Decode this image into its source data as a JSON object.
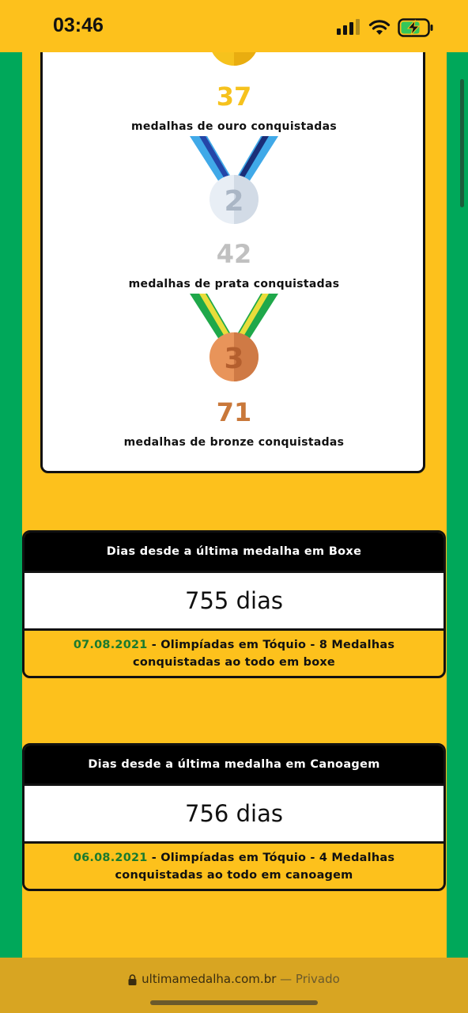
{
  "status_bar": {
    "time": "03:46"
  },
  "medals": {
    "gold": {
      "count": "37",
      "caption": "medalhas de ouro conquistadas",
      "color": "#f6c21d"
    },
    "silver": {
      "count": "42",
      "caption": "medalhas de prata conquistadas",
      "color": "#c0c0c0",
      "badge": "2"
    },
    "bronze": {
      "count": "71",
      "caption": "medalhas de bronze conquistadas",
      "color": "#c9783a",
      "badge": "3"
    }
  },
  "cards": [
    {
      "header": "Dias desde a última medalha em Boxe",
      "days": "755 dias",
      "date": "07.08.2021",
      "description": " - Olimpíadas em Tóquio - 8 Medalhas conquistadas ao todo em boxe"
    },
    {
      "header": "Dias desde a última medalha em Canoagem",
      "days": "756 dias",
      "date": "06.08.2021",
      "description": " - Olimpíadas em Tóquio - 4 Medalhas conquistadas ao todo em canoagem"
    }
  ],
  "browser": {
    "url": "ultimamedalha.com.br",
    "privacy": " — Privado"
  },
  "colors": {
    "brand_yellow": "#fdc11c",
    "brand_green": "#00a85a",
    "date_green": "#1a7a2e"
  }
}
